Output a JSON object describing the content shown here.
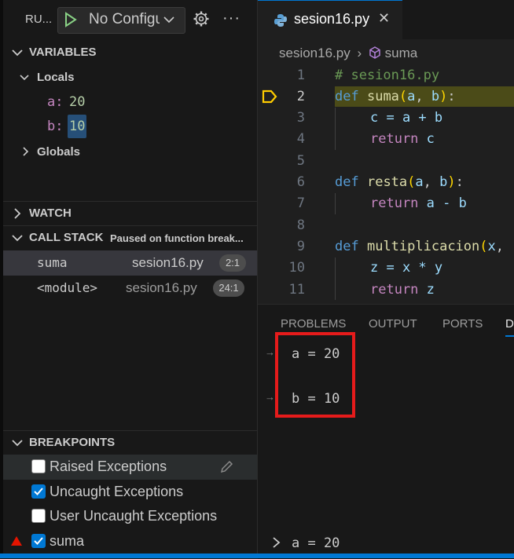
{
  "toolbar": {
    "run_label": "RU...",
    "config_select": "No Configu"
  },
  "variables": {
    "title": "VARIABLES",
    "locals_label": "Locals",
    "locals": [
      {
        "name": "a:",
        "value": "20"
      },
      {
        "name": "b:",
        "value": "10"
      }
    ],
    "globals_label": "Globals"
  },
  "watch": {
    "title": "WATCH"
  },
  "call_stack": {
    "title": "CALL STACK",
    "status": "Paused on function break...",
    "frames": [
      {
        "name": "suma",
        "file": "sesion16.py",
        "position": "2:1"
      },
      {
        "name": "<module>",
        "file": "sesion16.py",
        "position": "24:1"
      }
    ]
  },
  "breakpoints": {
    "title": "BREAKPOINTS",
    "items": [
      {
        "label": "Raised Exceptions",
        "checked": false
      },
      {
        "label": "Uncaught Exceptions",
        "checked": true
      },
      {
        "label": "User Uncaught Exceptions",
        "checked": false
      },
      {
        "label": "suma",
        "checked": true
      }
    ]
  },
  "editor": {
    "tab_label": "sesion16.py",
    "breadcrumb_file": "sesion16.py",
    "breadcrumb_symbol": "suma",
    "line_numbers": [
      "1",
      "2",
      "3",
      "4",
      "5",
      "6",
      "7",
      "8",
      "9",
      "10",
      "11"
    ],
    "current_line": "2",
    "code": {
      "l1": "# sesion16.py",
      "kw_def": "def",
      "kw_return": "return",
      "fn_suma": "suma",
      "fn_resta": "resta",
      "fn_mult": "multiplicacion",
      "l3": "c = a + b",
      "l4_rest": "c",
      "l7_rest": "a - b",
      "l10": "z = x * y",
      "l11_rest": "z"
    }
  },
  "panel": {
    "tabs": [
      "PROBLEMS",
      "OUTPUT",
      "PORTS",
      "D"
    ],
    "output_lines": [
      "a = 20",
      "b = 10"
    ],
    "repl_input": "a = 20"
  },
  "colors": {
    "accent": "#0078d4",
    "highlight_box": "#e51b1b",
    "current_line_bg": "#4b4b18",
    "breakpoint_marker": "#ffcc00",
    "function_breakpoint": "#e51400"
  }
}
